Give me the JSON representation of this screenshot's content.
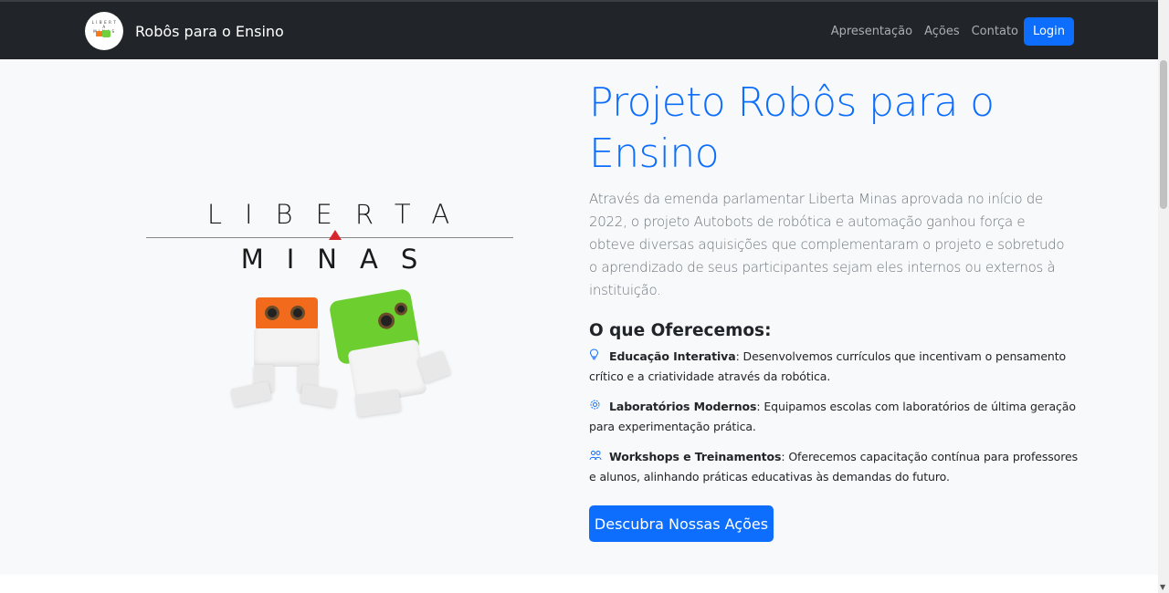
{
  "navbar": {
    "brand": "Robôs para o Ensino",
    "links": [
      "Apresentação",
      "Ações",
      "Contato"
    ],
    "login_label": "Login"
  },
  "hero": {
    "logo_top": "LIBERTA",
    "logo_bottom": "MINAS",
    "title": "Projeto Robôs para o Ensino",
    "lead": "Através da emenda parlamentar Liberta Minas aprovada no início de 2022, o projeto Autobots de robótica e automação ganhou força e obteve diversas aquisições que complementaram o projeto e sobretudo o aprendizado de seus participantes sejam eles internos ou externos à instituição.",
    "offer_title": "O que Oferecemos:",
    "offers": [
      {
        "icon": "lightbulb-icon",
        "title": "Educação Interativa",
        "text": ": Desenvolvemos currículos que incentivam o pensamento crítico e a criatividade através da robótica."
      },
      {
        "icon": "gear-icon",
        "title": "Laboratórios Modernos",
        "text": ": Equipamos escolas com laboratórios de última geração para experimentação prática."
      },
      {
        "icon": "people-icon",
        "title": "Workshops e Treinamentos",
        "text": ": Oferecemos capacitação contínua para professores e alunos, alinhando práticas educativas às demandas do futuro."
      }
    ],
    "cta_label": "Descubra Nossas Ações"
  },
  "colors": {
    "accent": "#0d6efd",
    "navbar": "#212529",
    "background": "#f8f9fa"
  }
}
